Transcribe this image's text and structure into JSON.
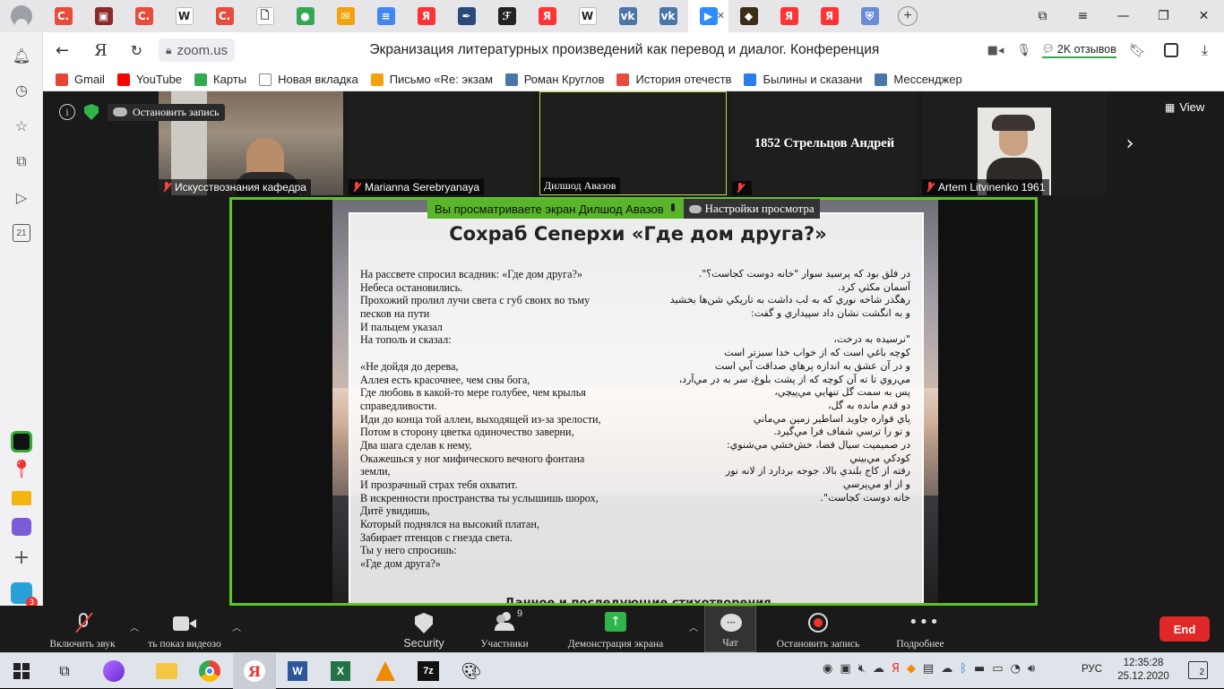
{
  "browser": {
    "tabs": [
      {
        "icon": "sova-icon",
        "color": "#e74c3c",
        "glyph": "С."
      },
      {
        "icon": "book-icon",
        "color": "#8b2a2a",
        "glyph": "▣"
      },
      {
        "icon": "sova-icon",
        "color": "#e74c3c",
        "glyph": "С."
      },
      {
        "icon": "wikipedia-icon",
        "color": "#ffffff",
        "glyph": "W"
      },
      {
        "icon": "sova-icon",
        "color": "#e74c3c",
        "glyph": "С."
      },
      {
        "icon": "document-icon",
        "color": "#ffffff",
        "glyph": "🗋"
      },
      {
        "icon": "chrome-icon",
        "color": "#34a853",
        "glyph": "●"
      },
      {
        "icon": "mail-icon",
        "color": "#f2a20c",
        "glyph": "✉"
      },
      {
        "icon": "docs-icon",
        "color": "#4285f4",
        "glyph": "≡"
      },
      {
        "icon": "yandex-icon",
        "color": "#ff3333",
        "glyph": "Я"
      },
      {
        "icon": "pen-icon",
        "color": "#2a4a7a",
        "glyph": "✒"
      },
      {
        "icon": "fp-icon",
        "color": "#222222",
        "glyph": "ℱ"
      },
      {
        "icon": "yandex-icon",
        "color": "#ff3333",
        "glyph": "Я"
      },
      {
        "icon": "wikipedia-icon",
        "color": "#ffffff",
        "glyph": "W"
      },
      {
        "icon": "vk-icon",
        "color": "#4a76a8",
        "glyph": "vk"
      },
      {
        "icon": "vk-icon",
        "color": "#4a76a8",
        "glyph": "vk"
      },
      {
        "icon": "zoom-icon",
        "color": "#2d8cff",
        "glyph": "▶"
      },
      {
        "icon": "dark-icon",
        "color": "#3b2d14",
        "glyph": "◆"
      },
      {
        "icon": "yandex-icon",
        "color": "#ff3333",
        "glyph": "Я"
      },
      {
        "icon": "yandex-icon",
        "color": "#ff3333",
        "glyph": "Я"
      },
      {
        "icon": "shield-icon",
        "color": "#6a8cd6",
        "glyph": "⛨"
      }
    ],
    "new_tab": "+",
    "address": "zoom.us",
    "page_title": "Экранизация литературных произведений как перевод и диалог. Конференция",
    "reviews": "2K отзывов",
    "bookmarks": [
      {
        "label": "Gmail",
        "color": "#ea4335",
        "icon": "gmail-icon"
      },
      {
        "label": "YouTube",
        "color": "#ff0000",
        "icon": "youtube-icon"
      },
      {
        "label": "Карты",
        "color": "#34a853",
        "icon": "maps-icon"
      },
      {
        "label": "Новая вкладка",
        "color": "#ffffff",
        "icon": "page-icon"
      },
      {
        "label": "Письмо «Re: экзам",
        "color": "#f2a20c",
        "icon": "mail-icon"
      },
      {
        "label": "Роман Круглов",
        "color": "#4a76a8",
        "icon": "vk-icon"
      },
      {
        "label": "История отечеств",
        "color": "#e74c3c",
        "icon": "history-icon"
      },
      {
        "label": "Былины и сказани",
        "color": "#2b7de9",
        "icon": "chat-icon"
      },
      {
        "label": "Мессенджер",
        "color": "#4a76a8",
        "icon": "vk-icon"
      }
    ],
    "side_badge": "21",
    "side_badge_count": "3"
  },
  "zoom": {
    "recording": "Остановить запись",
    "view_label": "View",
    "participants": [
      {
        "name": "Искусствознания кафедра",
        "muted": true
      },
      {
        "name": "Marianna Serebryanaya",
        "muted": true
      },
      {
        "name": "Дилшод Авазов",
        "muted": false
      },
      {
        "name": "",
        "big": "1852 Стрельцов Андрей",
        "muted": true
      },
      {
        "name": "Artem Litvinenko 1961",
        "muted": true
      }
    ],
    "banner": {
      "viewing": "Вы просматриваете экран Дилшод Авазов",
      "settings": "Настройки просмотра"
    },
    "slide": {
      "title": "Сохраб Сеперхи «Где дом друга?»",
      "ru": [
        "На рассвете спросил всадник: «Где дом друга?»",
        "Небеса остановились.",
        "Прохожий пролил лучи света с губ своих во тьму",
        "песков на пути",
        "И пальцем указал",
        "На тополь и сказал:",
        "",
        "«Не дойдя до дерева,",
        "Аллея есть красочнее, чем сны бога,",
        "Где любовь в какой-то мере голубее, чем крылья",
        "справедливости.",
        "Иди до конца той аллеи, выходящей из-за зрелости,",
        "Потом в сторону цветка одиночество заверни,",
        "Два шага сделав к нему,",
        "Окажешься у ног мифического вечного фонтана",
        "земли,",
        "И прозрачный страх тебя охватит.",
        "В искренности пространства ты услышишь шорох,",
        "Дитё увидишь,",
        "Который поднялся на высокий платан,",
        "Забирает птенцов с гнезда света.",
        "Ты у него спросишь:",
        "«Где дом друга?»"
      ],
      "fa": [
        "در فلق بود كه پرسيد سوار \"خانه دوست كجاست؟\".",
        "آسمان مكثي كرد.",
        "رهگذر شاخه نوري كه به لب داشت به تاريكي شن‌ها بخشيد",
        "و به انگشت نشان داد سپيداري و گفت:",
        "",
        "\"نرسيده به درخت،",
        "كوچه باغي است كه از خواب خدا سبزتر است",
        "و در آن عشق به اندازه پرهاي صداقت آبي است",
        "مي‌روي تا ته آن كوچه كه از پشت بلوغ، سر به در مي‌آرد،",
        "پس به سمت گل تنهايي مي‌پيچي،",
        "دو قدم مانده به گل،",
        "پاي فواره جاويد اساطير زمين مي‌ماني",
        "و تو را ترسي شفاف فرا مي‌گيرد.",
        "در صميميت سيال فضا، خش‌خشي مي‌شنوي:",
        "كودكي مي‌بيني",
        "رفته از كاج بلندي بالا، جوجه بردارد از لانه نور",
        "و از او مي‌پرسي",
        "خانه دوست كجاست\"."
      ],
      "footer": "Данное и последующие стихотворения"
    }
  },
  "toolbar": {
    "mute": "Включить звук",
    "video": "ть показ видеозо",
    "security": "Security",
    "participants": "Участники",
    "participants_count": "9",
    "share": "Демонстрация экрана",
    "chat": "Чат",
    "record": "Остановить запись",
    "more": "Подробнее",
    "end": "End"
  },
  "taskbar": {
    "lang": "РУС",
    "time": "12:35:28",
    "date": "25.12.2020",
    "notifications": "2"
  }
}
